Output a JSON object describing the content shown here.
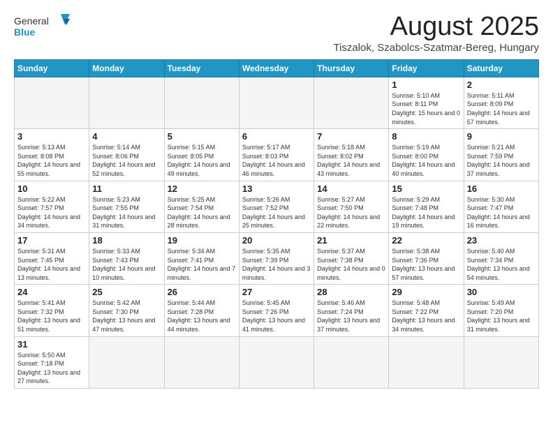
{
  "header": {
    "logo_general": "General",
    "logo_blue": "Blue",
    "title": "August 2025",
    "subtitle": "Tiszalok, Szabolcs-Szatmar-Bereg, Hungary"
  },
  "weekdays": [
    "Sunday",
    "Monday",
    "Tuesday",
    "Wednesday",
    "Thursday",
    "Friday",
    "Saturday"
  ],
  "weeks": [
    [
      {
        "day": "",
        "info": ""
      },
      {
        "day": "",
        "info": ""
      },
      {
        "day": "",
        "info": ""
      },
      {
        "day": "",
        "info": ""
      },
      {
        "day": "",
        "info": ""
      },
      {
        "day": "1",
        "info": "Sunrise: 5:10 AM\nSunset: 8:11 PM\nDaylight: 15 hours and 0 minutes."
      },
      {
        "day": "2",
        "info": "Sunrise: 5:11 AM\nSunset: 8:09 PM\nDaylight: 14 hours and 57 minutes."
      }
    ],
    [
      {
        "day": "3",
        "info": "Sunrise: 5:13 AM\nSunset: 8:08 PM\nDaylight: 14 hours and 55 minutes."
      },
      {
        "day": "4",
        "info": "Sunrise: 5:14 AM\nSunset: 8:06 PM\nDaylight: 14 hours and 52 minutes."
      },
      {
        "day": "5",
        "info": "Sunrise: 5:15 AM\nSunset: 8:05 PM\nDaylight: 14 hours and 49 minutes."
      },
      {
        "day": "6",
        "info": "Sunrise: 5:17 AM\nSunset: 8:03 PM\nDaylight: 14 hours and 46 minutes."
      },
      {
        "day": "7",
        "info": "Sunrise: 5:18 AM\nSunset: 8:02 PM\nDaylight: 14 hours and 43 minutes."
      },
      {
        "day": "8",
        "info": "Sunrise: 5:19 AM\nSunset: 8:00 PM\nDaylight: 14 hours and 40 minutes."
      },
      {
        "day": "9",
        "info": "Sunrise: 5:21 AM\nSunset: 7:59 PM\nDaylight: 14 hours and 37 minutes."
      }
    ],
    [
      {
        "day": "10",
        "info": "Sunrise: 5:22 AM\nSunset: 7:57 PM\nDaylight: 14 hours and 34 minutes."
      },
      {
        "day": "11",
        "info": "Sunrise: 5:23 AM\nSunset: 7:55 PM\nDaylight: 14 hours and 31 minutes."
      },
      {
        "day": "12",
        "info": "Sunrise: 5:25 AM\nSunset: 7:54 PM\nDaylight: 14 hours and 28 minutes."
      },
      {
        "day": "13",
        "info": "Sunrise: 5:26 AM\nSunset: 7:52 PM\nDaylight: 14 hours and 25 minutes."
      },
      {
        "day": "14",
        "info": "Sunrise: 5:27 AM\nSunset: 7:50 PM\nDaylight: 14 hours and 22 minutes."
      },
      {
        "day": "15",
        "info": "Sunrise: 5:29 AM\nSunset: 7:48 PM\nDaylight: 14 hours and 19 minutes."
      },
      {
        "day": "16",
        "info": "Sunrise: 5:30 AM\nSunset: 7:47 PM\nDaylight: 14 hours and 16 minutes."
      }
    ],
    [
      {
        "day": "17",
        "info": "Sunrise: 5:31 AM\nSunset: 7:45 PM\nDaylight: 14 hours and 13 minutes."
      },
      {
        "day": "18",
        "info": "Sunrise: 5:33 AM\nSunset: 7:43 PM\nDaylight: 14 hours and 10 minutes."
      },
      {
        "day": "19",
        "info": "Sunrise: 5:34 AM\nSunset: 7:41 PM\nDaylight: 14 hours and 7 minutes."
      },
      {
        "day": "20",
        "info": "Sunrise: 5:35 AM\nSunset: 7:39 PM\nDaylight: 14 hours and 3 minutes."
      },
      {
        "day": "21",
        "info": "Sunrise: 5:37 AM\nSunset: 7:38 PM\nDaylight: 14 hours and 0 minutes."
      },
      {
        "day": "22",
        "info": "Sunrise: 5:38 AM\nSunset: 7:36 PM\nDaylight: 13 hours and 57 minutes."
      },
      {
        "day": "23",
        "info": "Sunrise: 5:40 AM\nSunset: 7:34 PM\nDaylight: 13 hours and 54 minutes."
      }
    ],
    [
      {
        "day": "24",
        "info": "Sunrise: 5:41 AM\nSunset: 7:32 PM\nDaylight: 13 hours and 51 minutes."
      },
      {
        "day": "25",
        "info": "Sunrise: 5:42 AM\nSunset: 7:30 PM\nDaylight: 13 hours and 47 minutes."
      },
      {
        "day": "26",
        "info": "Sunrise: 5:44 AM\nSunset: 7:28 PM\nDaylight: 13 hours and 44 minutes."
      },
      {
        "day": "27",
        "info": "Sunrise: 5:45 AM\nSunset: 7:26 PM\nDaylight: 13 hours and 41 minutes."
      },
      {
        "day": "28",
        "info": "Sunrise: 5:46 AM\nSunset: 7:24 PM\nDaylight: 13 hours and 37 minutes."
      },
      {
        "day": "29",
        "info": "Sunrise: 5:48 AM\nSunset: 7:22 PM\nDaylight: 13 hours and 34 minutes."
      },
      {
        "day": "30",
        "info": "Sunrise: 5:49 AM\nSunset: 7:20 PM\nDaylight: 13 hours and 31 minutes."
      }
    ],
    [
      {
        "day": "31",
        "info": "Sunrise: 5:50 AM\nSunset: 7:18 PM\nDaylight: 13 hours and 27 minutes."
      },
      {
        "day": "",
        "info": ""
      },
      {
        "day": "",
        "info": ""
      },
      {
        "day": "",
        "info": ""
      },
      {
        "day": "",
        "info": ""
      },
      {
        "day": "",
        "info": ""
      },
      {
        "day": "",
        "info": ""
      }
    ]
  ]
}
